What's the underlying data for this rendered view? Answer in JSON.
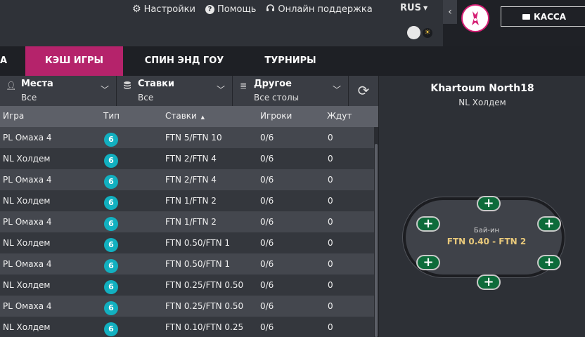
{
  "header": {
    "settings": "Настройки",
    "help": "Помощь",
    "support": "Онлайн поддержка",
    "language": "RUS",
    "cashier": "КАССА"
  },
  "tabs": [
    {
      "label": "А",
      "active": false
    },
    {
      "label": "КЭШ ИГРЫ",
      "active": true
    },
    {
      "label": "СПИН ЭНД  ГОУ",
      "active": false
    },
    {
      "label": "ТУРНИРЫ",
      "active": false
    }
  ],
  "filters": [
    {
      "title": "Места",
      "value": "Все",
      "icon": "user-icon"
    },
    {
      "title": "Ставки",
      "value": "Все",
      "icon": "coins-icon"
    },
    {
      "title": "Другое",
      "value": "Все столы",
      "icon": "list-icon"
    }
  ],
  "table": {
    "columns": [
      "Игра",
      "Тип",
      "Ставки",
      "Игроки",
      "Ждут"
    ],
    "sort_indicator": "▲",
    "rows": [
      {
        "game": "PL Омаха 4",
        "type": "6",
        "stakes": "FTN 5/FTN 10",
        "players": "0/6",
        "waiting": "0"
      },
      {
        "game": "NL Холдем",
        "type": "6",
        "stakes": "FTN 2/FTN 4",
        "players": "0/6",
        "waiting": "0"
      },
      {
        "game": "PL Омаха 4",
        "type": "6",
        "stakes": "FTN 2/FTN 4",
        "players": "0/6",
        "waiting": "0"
      },
      {
        "game": "NL Холдем",
        "type": "6",
        "stakes": "FTN 1/FTN 2",
        "players": "0/6",
        "waiting": "0"
      },
      {
        "game": "PL Омаха 4",
        "type": "6",
        "stakes": "FTN 1/FTN 2",
        "players": "0/6",
        "waiting": "0"
      },
      {
        "game": "NL Холдем",
        "type": "6",
        "stakes": "FTN 0.50/FTN 1",
        "players": "0/6",
        "waiting": "0"
      },
      {
        "game": "PL Омаха 4",
        "type": "6",
        "stakes": "FTN 0.50/FTN 1",
        "players": "0/6",
        "waiting": "0"
      },
      {
        "game": "NL Холдем",
        "type": "6",
        "stakes": "FTN 0.25/FTN 0.50",
        "players": "0/6",
        "waiting": "0"
      },
      {
        "game": "PL Омаха 4",
        "type": "6",
        "stakes": "FTN 0.25/FTN 0.50",
        "players": "0/6",
        "waiting": "0"
      },
      {
        "game": "NL Холдем",
        "type": "6",
        "stakes": "FTN 0.10/FTN 0.25",
        "players": "0/6",
        "waiting": "0"
      }
    ]
  },
  "preview": {
    "table_name": "Khartoum North18",
    "game_type": "NL Холдем",
    "buyin_label": "Бай-ин",
    "buyin_value": "FTN 0.40 - FTN 2",
    "seat_symbol": "+"
  },
  "colors": {
    "accent": "#b5236b",
    "badge": "#12b0c0",
    "seat": "#0d6b3a",
    "buyin": "#e8c87a"
  }
}
